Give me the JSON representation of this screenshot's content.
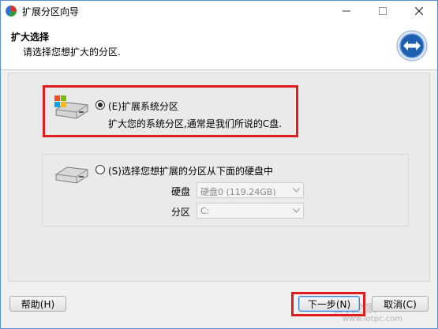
{
  "window": {
    "title": "扩展分区向导",
    "controls": {
      "minimize": "—",
      "maximize": "☐",
      "close": "✕"
    }
  },
  "header": {
    "title": "扩大选择",
    "subtitle": "请选择您想扩大的分区."
  },
  "options": {
    "system": {
      "label": "(E)扩展系统分区",
      "description": "扩大您的系统分区,通常是我们所说的C盘.",
      "selected": true
    },
    "choose": {
      "label": "(S)选择您想扩展的分区从下面的硬盘中",
      "selected": false,
      "disk_label": "硬盘",
      "disk_value": "硬盘0 (119.24GB)",
      "partition_label": "分区",
      "partition_value": "C:"
    }
  },
  "footer": {
    "help": "帮助(H)",
    "next": "下一步(N)",
    "cancel": "取消(C)"
  },
  "watermark": {
    "text": "装机之家",
    "url": "www.lotpc.com"
  },
  "colors": {
    "highlight": "#e01c1c",
    "title_border": "#5a8fd3"
  }
}
